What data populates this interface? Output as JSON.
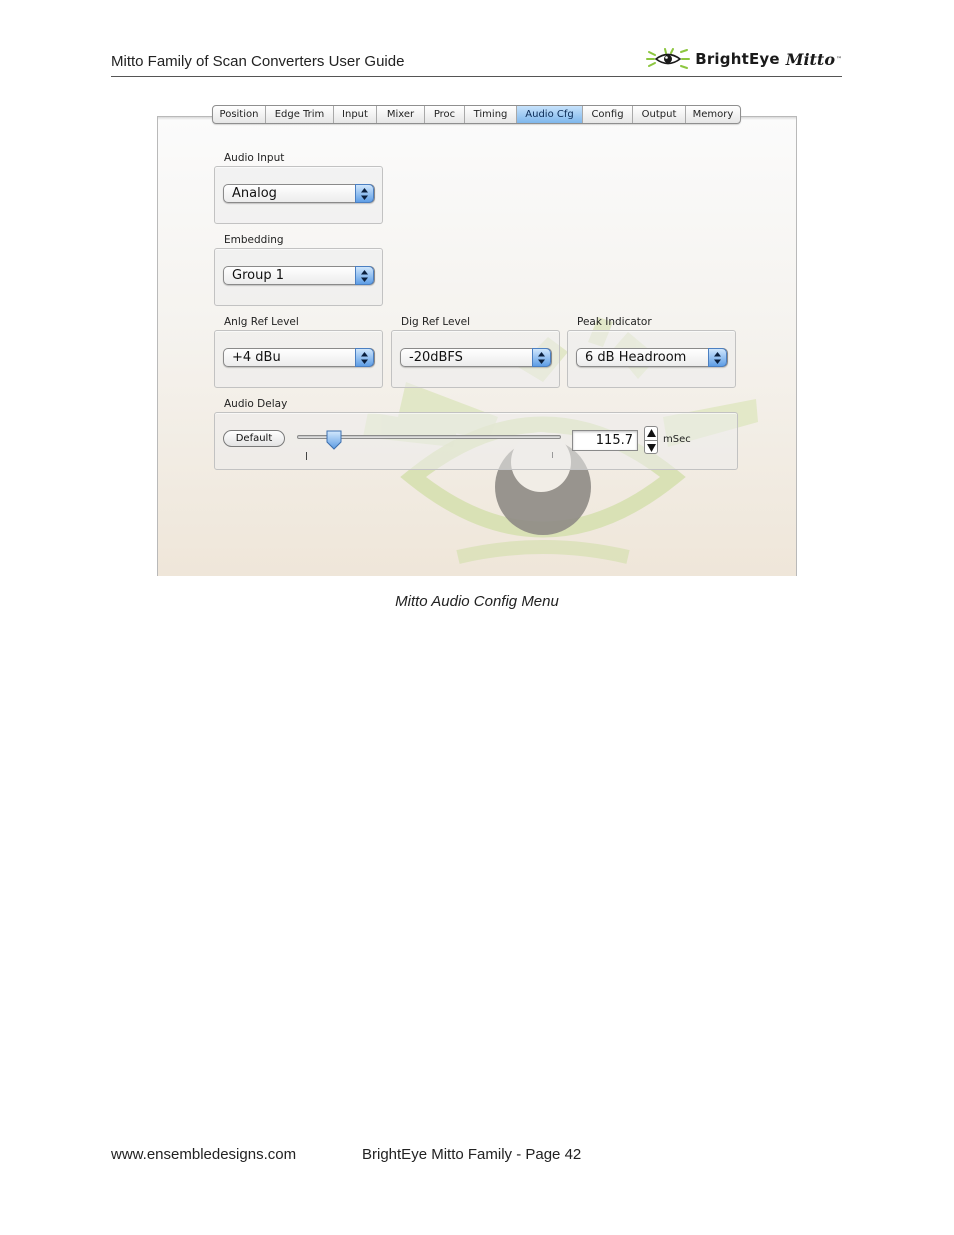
{
  "header": {
    "title": "Mitto Family of Scan Converters User Guide",
    "brand": {
      "name": "BrightEye",
      "product": "Mitto",
      "tm": "™",
      "logo_icon": "eye-logo-icon",
      "accent": "#8cc63f"
    }
  },
  "ui": {
    "tabs": [
      {
        "label": "Position",
        "active": false
      },
      {
        "label": "Edge Trim",
        "active": false
      },
      {
        "label": "Input",
        "active": false
      },
      {
        "label": "Mixer",
        "active": false
      },
      {
        "label": "Proc",
        "active": false
      },
      {
        "label": "Timing",
        "active": false
      },
      {
        "label": "Audio Cfg",
        "active": true
      },
      {
        "label": "Config",
        "active": false
      },
      {
        "label": "Output",
        "active": false
      },
      {
        "label": "Memory",
        "active": false
      }
    ],
    "audio_input": {
      "label": "Audio Input",
      "value": "Analog"
    },
    "embedding": {
      "label": "Embedding",
      "value": "Group 1"
    },
    "anlg_ref_level": {
      "label": "Anlg Ref Level",
      "value": "+4 dBu"
    },
    "dig_ref_level": {
      "label": "Dig Ref Level",
      "value": "-20dBFS"
    },
    "peak_indicator": {
      "label": "Peak Indicator",
      "value": "6 dB Headroom"
    },
    "audio_delay": {
      "label": "Audio Delay",
      "default_button": "Default",
      "value": "115.7",
      "unit": "mSec",
      "slider_fraction": 0.14
    }
  },
  "caption": "Mitto Audio Config Menu",
  "footer": {
    "website": "www.ensembledesigns.com",
    "page": "BrightEye Mitto Family - Page 42"
  }
}
